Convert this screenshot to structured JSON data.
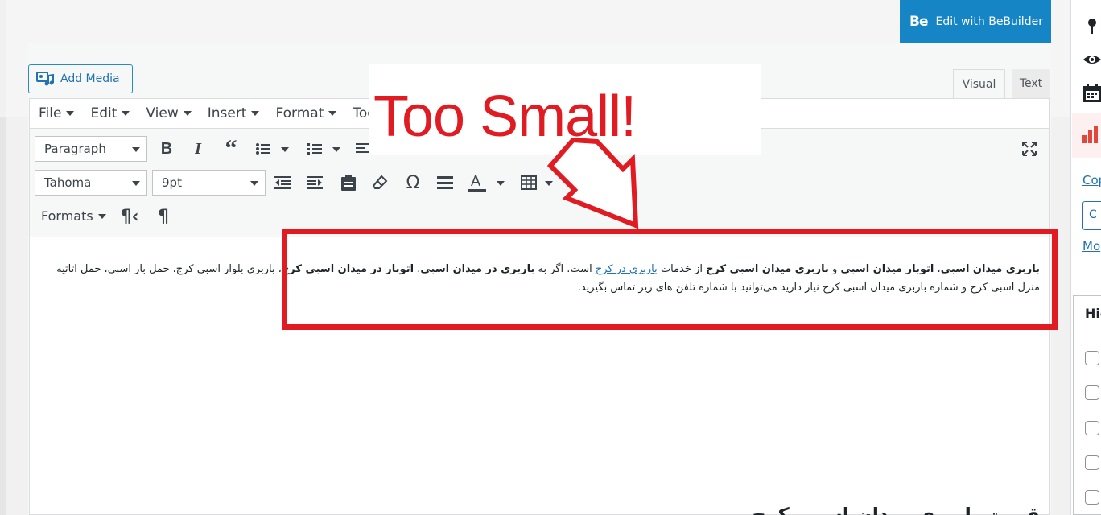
{
  "bebuilder": {
    "logo": "Be",
    "label": "Edit with BeBuilder"
  },
  "add_media": {
    "label": "Add Media"
  },
  "tabs": {
    "visual": "Visual",
    "text": "Text"
  },
  "menubar": [
    "File",
    "Edit",
    "View",
    "Insert",
    "Format",
    "Tools"
  ],
  "toolbar": {
    "block_format": "Paragraph",
    "font_family": "Tahoma",
    "font_size": "9pt",
    "formats": "Formats",
    "omega": "Ω",
    "help": "?"
  },
  "content": {
    "paragraph": {
      "s1": "باربری میدان اسبی",
      "s2": "، ",
      "s3": "اتوبار میدان اسبی",
      "s4": " و ",
      "s5": "باربری میدان اسبی کرج",
      "s6": " از خدمات ",
      "link": "باربری در کرج",
      "s7": " است. اگر به ",
      "s8": "باربری در میدان اسبی",
      "s9": "، ",
      "s10": "اتوبار در میدان اسبی کرج",
      "s11": "، باربری بلوار اسبی کرج، حمل بار اسبی، حمل اثاثیه منزل اسبی کرج و شماره باربری میدان اسبی کرج نیاز دارید می‌توانید با شماره تلفن های زیر تماس بگیرید."
    },
    "heading": "قیمت باربری میدان اسبی کرج"
  },
  "annotation": {
    "text": "Too Small!",
    "color": "#e01b22"
  },
  "sidebar": {
    "link_copy": "Cop",
    "button": "C",
    "link_more": "Mo",
    "panel_title": "Hid",
    "checkbox_count": 5
  }
}
